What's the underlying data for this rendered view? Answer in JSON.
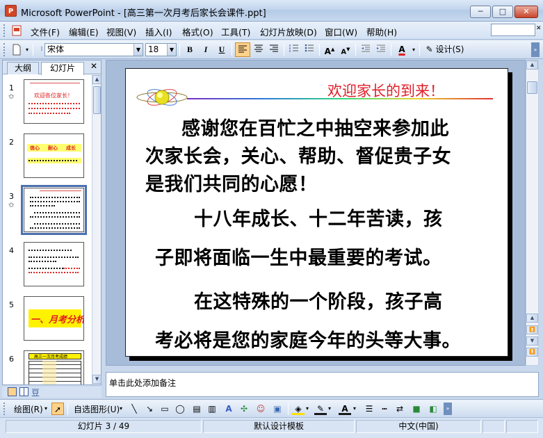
{
  "window": {
    "title": "Microsoft PowerPoint - [高三第一次月考后家长会课件.ppt]",
    "app_icon_letter": "P",
    "minimize": "─",
    "maximize": "□",
    "close": "✕"
  },
  "menu": {
    "items": [
      "文件(F)",
      "编辑(E)",
      "视图(V)",
      "插入(I)",
      "格式(O)",
      "工具(T)",
      "幻灯片放映(D)",
      "窗口(W)",
      "帮助(H)"
    ]
  },
  "toolbar": {
    "font_name": "宋体",
    "font_size": "18",
    "bold": "B",
    "italic": "I",
    "underline": "U",
    "design_label": "设计(S)"
  },
  "left_pane": {
    "tabs": [
      "大纲",
      "幻灯片"
    ],
    "close": "✕",
    "slide_numbers": [
      "1",
      "2",
      "3",
      "4",
      "5",
      "6"
    ],
    "star": "✩",
    "thumb1_title": "欢迎各位家长！",
    "thumb2_words": [
      "信心",
      "耐心",
      "成长"
    ],
    "thumb5_text": "一、月考分析",
    "thumb6_header": "高三一次月考成绩"
  },
  "slide": {
    "heading": "欢迎家长的到来！",
    "lines": [
      "感谢您在百忙之中抽空来参加此",
      "次家长会，关心、帮助、督促贵子女",
      "是我们共同的心愿！",
      "十八年成长、十二年苦读，孩",
      "子即将面临一生中最重要的考试。",
      "在这特殊的一个阶段，孩子高",
      "考必将是您的家庭今年的头等大事。"
    ]
  },
  "notes": {
    "placeholder": "单击此处添加备注"
  },
  "drawbar": {
    "draw_label": "绘图(R)",
    "autoshapes_label": "自选图形(U)"
  },
  "status": {
    "slide_counter": "幻灯片 3 / 49",
    "template": "默认设计模板",
    "language": "中文(中国)"
  },
  "colors": {
    "accent_heading": "#e0202a",
    "selection": "#4a70b0"
  }
}
